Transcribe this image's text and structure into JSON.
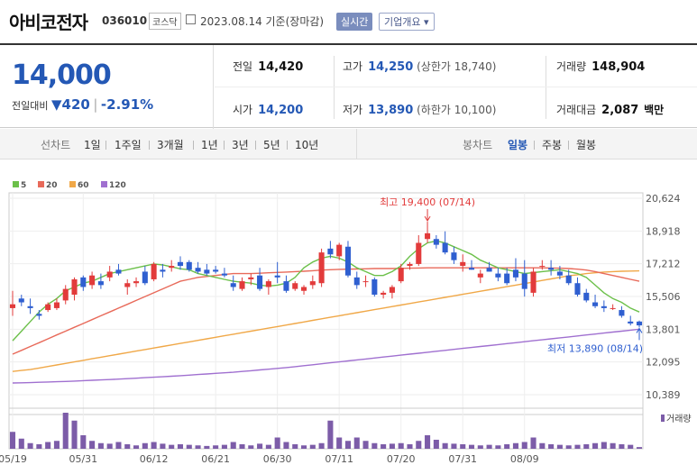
{
  "header": {
    "name": "아비코전자",
    "code": "036010",
    "market": "코스닥",
    "asof": "2023.08.14 기준(장마감)",
    "realtime_label": "실시간",
    "company_info_label": "기업개요 ▾"
  },
  "quote": {
    "price": "14,000",
    "change_label": "전일대비",
    "change_value": "420",
    "change_pct": "-2.91%",
    "prev_close_label": "전일",
    "prev_close": "14,420",
    "open_label": "시가",
    "open": "14,200",
    "high_label": "고가",
    "high": "14,250",
    "upper_limit": "(상한가 18,740)",
    "low_label": "저가",
    "low": "13,890",
    "lower_limit": "(하한가 10,100)",
    "volume_label": "거래량",
    "volume": "148,904",
    "value_label": "거래대금",
    "value": "2,087",
    "value_unit": "백만"
  },
  "tabs": {
    "line_label": "선차트",
    "line_periods": [
      "1일",
      "1주일",
      "3개월",
      "1년",
      "3년",
      "5년",
      "10년"
    ],
    "candle_label": "봉차트",
    "candle_periods": [
      "일봉",
      "주봉",
      "월봉"
    ],
    "candle_active": "일봉"
  },
  "colors": {
    "up": "#e23b3b",
    "down": "#2f5fd0",
    "ma5": "#6cc04a",
    "ma20": "#e86a5a",
    "ma60": "#f0a848",
    "ma120": "#a070d0",
    "volume": "#7c5ca8"
  },
  "chart_data": {
    "type": "candlestick",
    "legend": [
      {
        "name": "5",
        "color": "#6cc04a"
      },
      {
        "name": "20",
        "color": "#e86a5a"
      },
      {
        "name": "60",
        "color": "#f0a848"
      },
      {
        "name": "120",
        "color": "#a070d0"
      }
    ],
    "y_ticks": [
      "20,624",
      "18,918",
      "17,212",
      "15,506",
      "13,801",
      "12,095",
      "10,389"
    ],
    "ylim": [
      10389,
      20624
    ],
    "x_labels": [
      "05/19",
      "05/31",
      "06/12",
      "06/21",
      "06/30",
      "07/11",
      "07/20",
      "07/31",
      "08/09"
    ],
    "x_label_index": [
      0,
      8,
      16,
      23,
      30,
      37,
      44,
      51,
      58
    ],
    "annotation_high": "최고 19,400 (07/14)",
    "annotation_low": "최저 13,890 (08/14)",
    "volume_label": "거래량",
    "candles": [
      [
        14900,
        15800,
        14500,
        15100
      ],
      [
        15400,
        15600,
        15000,
        15200
      ],
      [
        15000,
        15400,
        14600,
        14900
      ],
      [
        14600,
        14800,
        14300,
        14500
      ],
      [
        14800,
        15200,
        14700,
        15100
      ],
      [
        14900,
        15400,
        14800,
        15200
      ],
      [
        15300,
        16100,
        15100,
        15900
      ],
      [
        15600,
        16500,
        15300,
        16400
      ],
      [
        16500,
        16600,
        15800,
        16000
      ],
      [
        16100,
        16800,
        15900,
        16600
      ],
      [
        16300,
        16700,
        15900,
        16100
      ],
      [
        16500,
        17100,
        16300,
        16800
      ],
      [
        16900,
        17200,
        16600,
        16700
      ],
      [
        16000,
        16400,
        15600,
        16200
      ],
      [
        16200,
        16500,
        16000,
        16300
      ],
      [
        16800,
        17100,
        16100,
        16200
      ],
      [
        16400,
        17300,
        16300,
        17200
      ],
      [
        16900,
        17200,
        16500,
        16800
      ],
      [
        17000,
        17400,
        16800,
        17100
      ],
      [
        17300,
        17600,
        16900,
        17100
      ],
      [
        17300,
        17400,
        16800,
        16900
      ],
      [
        17000,
        17300,
        16700,
        16800
      ],
      [
        16900,
        17200,
        16600,
        16700
      ],
      [
        16900,
        17100,
        16700,
        16800
      ],
      [
        16700,
        17000,
        16500,
        16600
      ],
      [
        16200,
        16600,
        15800,
        16000
      ],
      [
        15900,
        16500,
        15800,
        16300
      ],
      [
        16400,
        16700,
        16100,
        16500
      ],
      [
        16600,
        17000,
        15800,
        15900
      ],
      [
        16000,
        16400,
        15600,
        16300
      ],
      [
        16600,
        17300,
        16200,
        16500
      ],
      [
        16300,
        16600,
        15700,
        15800
      ],
      [
        15900,
        16300,
        15800,
        16200
      ],
      [
        15800,
        16100,
        15600,
        16000
      ],
      [
        16100,
        16600,
        15900,
        16300
      ],
      [
        16200,
        18000,
        16000,
        17800
      ],
      [
        18000,
        18400,
        17500,
        17700
      ],
      [
        17600,
        18300,
        17400,
        18200
      ],
      [
        18100,
        18400,
        16500,
        16600
      ],
      [
        16500,
        16800,
        15900,
        16100
      ],
      [
        16300,
        16600,
        16000,
        16300
      ],
      [
        16400,
        16500,
        15500,
        15600
      ],
      [
        15600,
        15800,
        15400,
        15700
      ],
      [
        15700,
        16100,
        15400,
        16000
      ],
      [
        16300,
        17200,
        16200,
        17000
      ],
      [
        17100,
        17300,
        16900,
        17200
      ],
      [
        17200,
        18700,
        17100,
        18300
      ],
      [
        18500,
        19400,
        18300,
        18800
      ],
      [
        18500,
        18700,
        18000,
        18200
      ],
      [
        18300,
        18900,
        17700,
        17800
      ],
      [
        17800,
        18100,
        17200,
        17400
      ],
      [
        17100,
        17700,
        16800,
        17300
      ],
      [
        17000,
        17400,
        16900,
        16900
      ],
      [
        16500,
        16900,
        16200,
        16700
      ],
      [
        17000,
        17300,
        16800,
        16800
      ],
      [
        16700,
        17000,
        16300,
        16500
      ],
      [
        16700,
        17000,
        16100,
        16200
      ],
      [
        16900,
        17500,
        16300,
        16500
      ],
      [
        16700,
        17400,
        15500,
        15900
      ],
      [
        15700,
        17000,
        15500,
        16800
      ],
      [
        17100,
        17400,
        16900,
        17100
      ],
      [
        17000,
        17400,
        16600,
        16900
      ],
      [
        16800,
        17100,
        16400,
        16600
      ],
      [
        16600,
        16900,
        16100,
        16200
      ],
      [
        16200,
        16500,
        15500,
        15600
      ],
      [
        15700,
        15900,
        15200,
        15300
      ],
      [
        15200,
        15600,
        14900,
        15000
      ],
      [
        15000,
        15300,
        14700,
        14900
      ],
      [
        14900,
        15100,
        14800,
        14900
      ],
      [
        14800,
        15000,
        14400,
        14500
      ],
      [
        14200,
        14500,
        14000,
        14100
      ],
      [
        14200,
        14250,
        13890,
        14000
      ]
    ],
    "ma5": [
      13200,
      13700,
      14200,
      14700,
      15100,
      15400,
      15800,
      16000,
      16200,
      16300,
      16500,
      16700,
      16800,
      16900,
      17000,
      17100,
      17200,
      17150,
      17050,
      16950,
      16900,
      16700,
      16600,
      16500,
      16400,
      16300,
      16250,
      16200,
      16100,
      16050,
      16100,
      16200,
      16500,
      17000,
      17300,
      17500,
      17600,
      17500,
      17300,
      17000,
      16800,
      16600,
      16600,
      16800,
      17100,
      17600,
      18000,
      18300,
      18400,
      18300,
      18100,
      17900,
      17700,
      17400,
      17200,
      17000,
      16900,
      16800,
      16700,
      16750,
      16800,
      16850,
      16900,
      16800,
      16700,
      16500,
      16100,
      15700,
      15400,
      15200,
      14900,
      14700
    ],
    "ma20": [
      12500,
      12700,
      12900,
      13100,
      13300,
      13500,
      13700,
      13900,
      14100,
      14300,
      14500,
      14700,
      14900,
      15100,
      15300,
      15500,
      15700,
      15900,
      16100,
      16300,
      16400,
      16500,
      16550,
      16600,
      16650,
      16700,
      16700,
      16700,
      16720,
      16740,
      16760,
      16780,
      16800,
      16820,
      16850,
      16880,
      16900,
      16920,
      16930,
      16940,
      16950,
      16960,
      16960,
      16960,
      16970,
      16980,
      16990,
      17000,
      17000,
      17000,
      17000,
      17000,
      17000,
      17000,
      17000,
      17000,
      17000,
      17000,
      17000,
      17000,
      17000,
      16990,
      16980,
      16960,
      16930,
      16880,
      16800,
      16700,
      16600,
      16500,
      16400,
      16300
    ],
    "ma60": [
      11600,
      11650,
      11700,
      11780,
      11860,
      11940,
      12020,
      12100,
      12180,
      12260,
      12340,
      12420,
      12500,
      12580,
      12660,
      12740,
      12820,
      12900,
      12980,
      13060,
      13140,
      13220,
      13300,
      13380,
      13460,
      13540,
      13620,
      13700,
      13780,
      13860,
      13940,
      14020,
      14100,
      14180,
      14260,
      14340,
      14420,
      14500,
      14580,
      14660,
      14740,
      14820,
      14900,
      14980,
      15060,
      15140,
      15220,
      15300,
      15380,
      15460,
      15540,
      15620,
      15700,
      15780,
      15860,
      15940,
      16020,
      16100,
      16180,
      16260,
      16340,
      16420,
      16500,
      16580,
      16640,
      16700,
      16740,
      16780,
      16800,
      16820,
      16830,
      16840
    ],
    "ma120": [
      11000,
      11010,
      11020,
      11035,
      11050,
      11065,
      11080,
      11100,
      11120,
      11140,
      11160,
      11180,
      11200,
      11225,
      11250,
      11275,
      11300,
      11325,
      11350,
      11380,
      11410,
      11440,
      11470,
      11500,
      11530,
      11560,
      11600,
      11640,
      11680,
      11720,
      11760,
      11800,
      11850,
      11900,
      11950,
      12000,
      12050,
      12100,
      12150,
      12200,
      12250,
      12300,
      12350,
      12400,
      12450,
      12500,
      12550,
      12600,
      12650,
      12700,
      12750,
      12800,
      12850,
      12900,
      12950,
      13000,
      13050,
      13100,
      13150,
      13200,
      13250,
      13300,
      13350,
      13400,
      13450,
      13500,
      13550,
      13600,
      13650,
      13700,
      13750,
      13800
    ],
    "volumes": [
      1500000,
      900000,
      500000,
      400000,
      600000,
      700000,
      3200000,
      2500000,
      1200000,
      700000,
      500000,
      450000,
      600000,
      400000,
      300000,
      500000,
      600000,
      450000,
      350000,
      400000,
      350000,
      300000,
      250000,
      300000,
      350000,
      600000,
      400000,
      300000,
      450000,
      350000,
      1000000,
      600000,
      400000,
      300000,
      350000,
      500000,
      2500000,
      1000000,
      700000,
      1000000,
      700000,
      500000,
      400000,
      450000,
      500000,
      400000,
      700000,
      1200000,
      800000,
      500000,
      450000,
      400000,
      350000,
      300000,
      350000,
      300000,
      400000,
      500000,
      600000,
      1000000,
      500000,
      400000,
      350000,
      300000,
      350000,
      400000,
      500000,
      600000,
      500000,
      400000,
      350000,
      150000
    ]
  }
}
